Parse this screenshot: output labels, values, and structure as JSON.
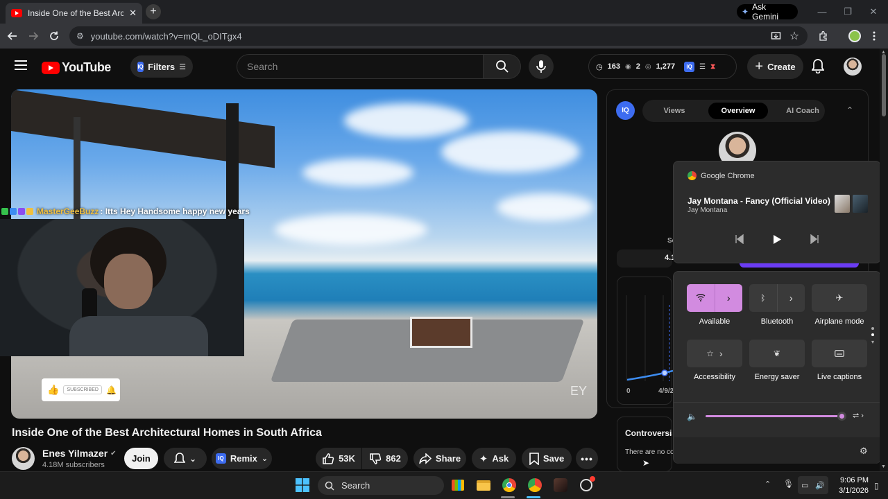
{
  "browser": {
    "tab_title": "Inside One of the Best Architectural Homes in South Africa",
    "gemini_label": "Ask Gemini",
    "url": "youtube.com/watch?v=mQL_oDITgx4"
  },
  "youtube": {
    "logo_text": "YouTube",
    "filters_label": "Filters",
    "iq_badge": "IQ",
    "search_placeholder": "Search",
    "stats": {
      "watching": "163",
      "visible": "2",
      "views": "1,277"
    },
    "create_label": "Create"
  },
  "video": {
    "watermark": "EY",
    "chat": {
      "username": "MasterGeeBuzz",
      "message": ": Itts Hey Handsome happy new years"
    },
    "subscribed_overlay": "SUBSCRIBED",
    "title": "Inside One of the Best Architectural Homes in South Africa"
  },
  "channel": {
    "name": "Enes Yilmazer",
    "subscribers": "4.18M subscribers",
    "join_label": "Join",
    "remix_label": "Remix",
    "likes": "53K",
    "dislikes": "862",
    "share_label": "Share",
    "ask_label": "Ask",
    "save_label": "Save"
  },
  "side_panel": {
    "tabs": [
      "Views",
      "Overview",
      "AI Coach"
    ],
    "active_tab": "Overview",
    "partial_stat_label": "Se",
    "partial_stat_value": "4.1",
    "chart_x_labels": [
      "0",
      "4/9/2"
    ],
    "controversy_title": "Controversia",
    "controversy_text": "There are no co"
  },
  "media_flyout": {
    "source": "Google Chrome",
    "track_title": "Jay Montana - Fancy (Official Video)",
    "artist": "Jay Montana"
  },
  "quick_settings": {
    "tiles": [
      {
        "label": "Available",
        "icon": "wifi-icon",
        "active": true,
        "has_arrow": true
      },
      {
        "label": "Bluetooth",
        "icon": "bluetooth-icon",
        "active": false,
        "has_arrow": true
      },
      {
        "label": "Airplane mode",
        "icon": "airplane-icon",
        "active": false,
        "has_arrow": false
      },
      {
        "label": "Accessibility",
        "icon": "accessibility-icon",
        "active": false,
        "has_arrow": true
      },
      {
        "label": "Energy saver",
        "icon": "leaf-icon",
        "active": false,
        "has_arrow": false
      },
      {
        "label": "Live captions",
        "icon": "captions-icon",
        "active": false,
        "has_arrow": false
      }
    ],
    "volume_fraction": 1.0
  },
  "taskbar": {
    "search_label": "Search",
    "time": "9:06 PM",
    "date": "3/1/2026"
  },
  "colors": {
    "youtube_red": "#ff0000",
    "iq_blue": "#3d6cf0",
    "quick_settings_accent": "#d28be0",
    "panel_purple": "#6b3cf5"
  }
}
